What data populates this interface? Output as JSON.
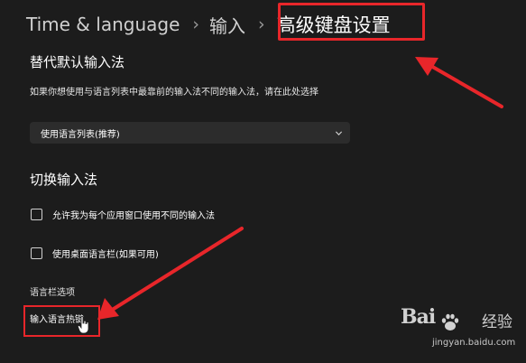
{
  "breadcrumb": {
    "items": [
      "Time & language",
      "输入"
    ],
    "current": "高级键盘设置"
  },
  "override_input": {
    "title": "替代默认输入法",
    "description": "如果你想使用与语言列表中最靠前的输入法不同的输入法，请在此处选择",
    "dropdown_value": "使用语言列表(推荐)"
  },
  "switch_input": {
    "title": "切换输入法",
    "options": [
      {
        "label": "允许我为每个应用窗口使用不同的输入法",
        "checked": false
      },
      {
        "label": "使用桌面语言栏(如果可用)",
        "checked": false
      }
    ]
  },
  "language_bar": {
    "title": "语言栏选项",
    "hotkeys_link": "输入语言热键"
  },
  "annotation_color": "#e8262a",
  "watermark": {
    "brand": "Bai",
    "brand2": "经验",
    "url": "jingyan.baidu.com"
  }
}
